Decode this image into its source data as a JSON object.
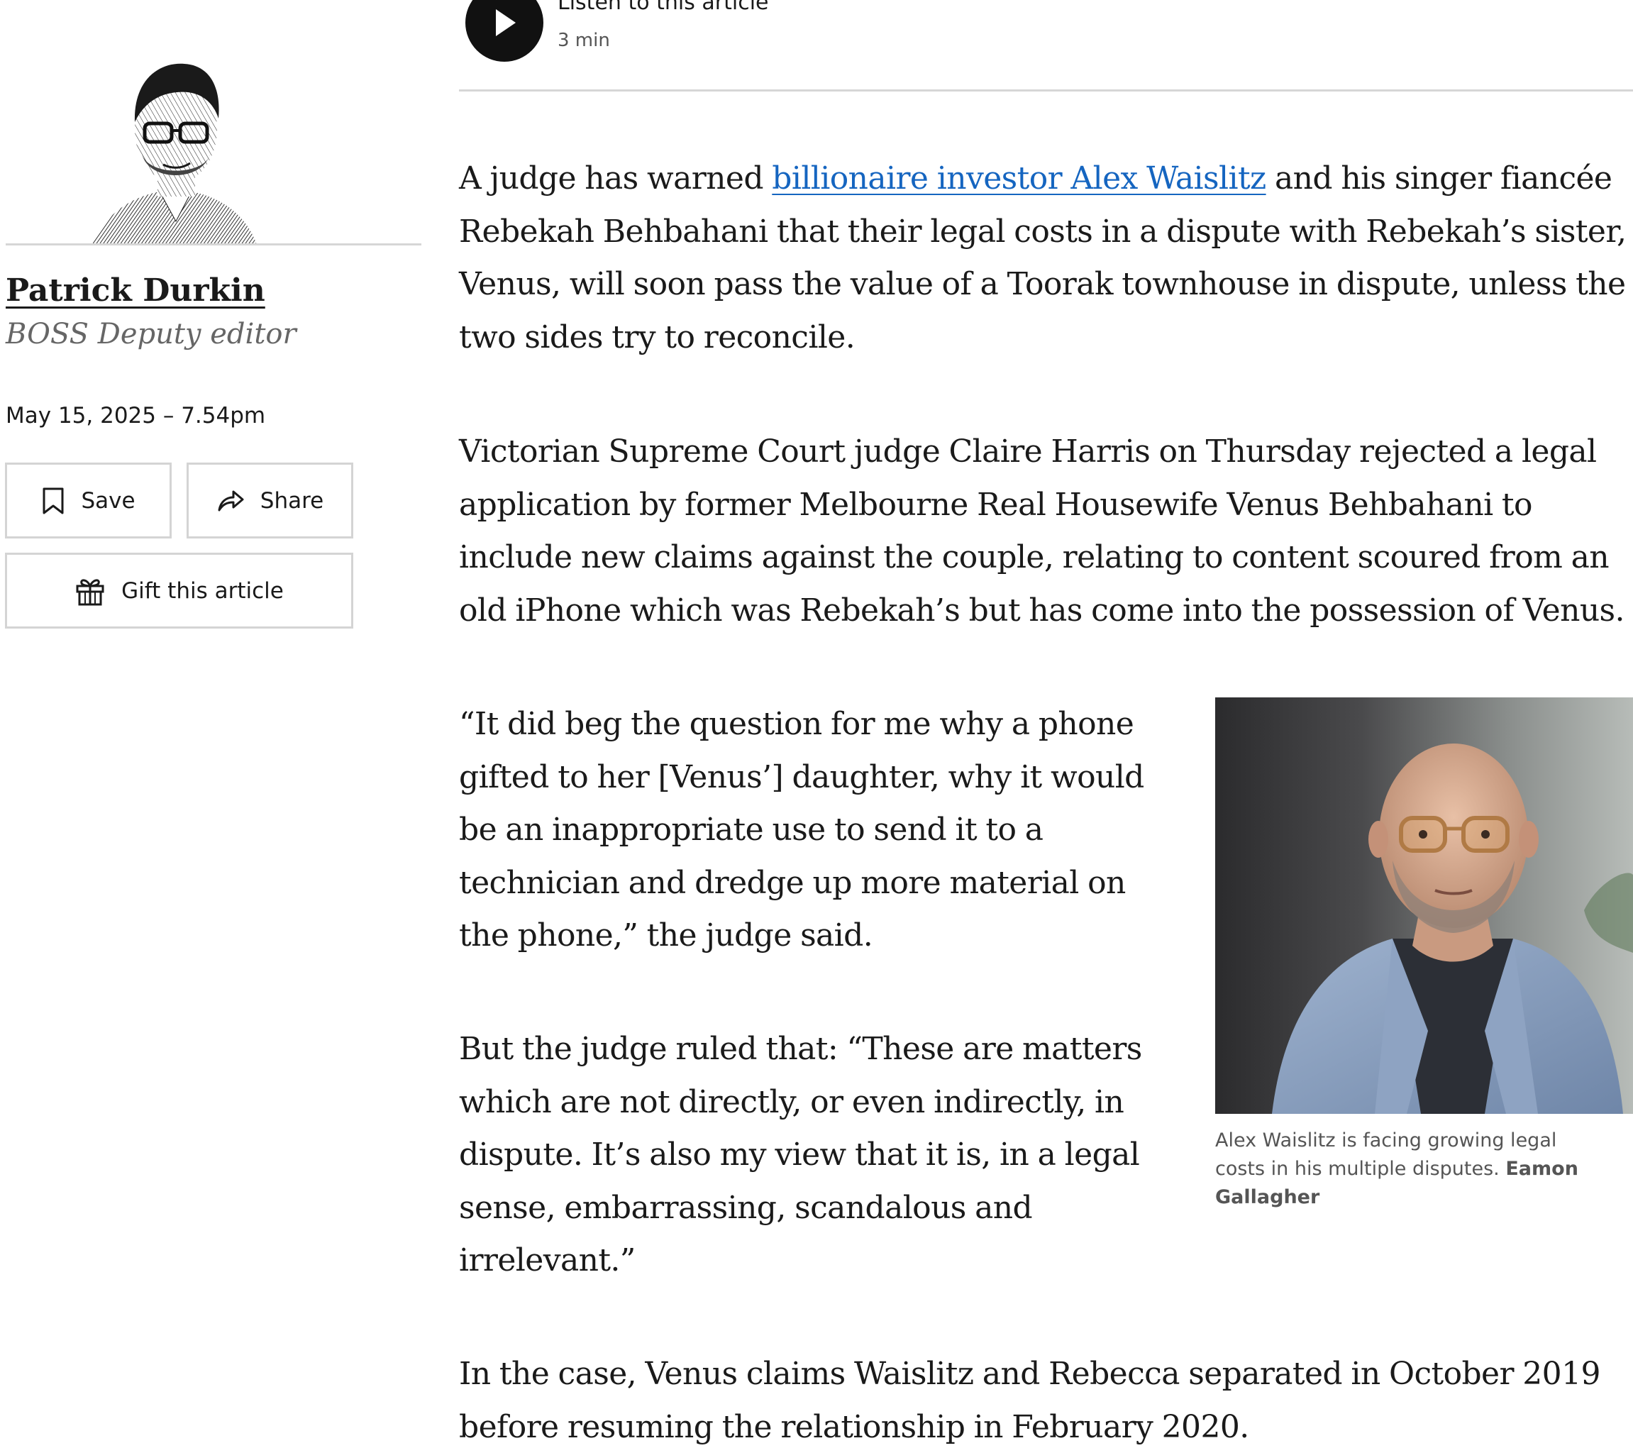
{
  "author": {
    "name": "Patrick Durkin",
    "role": "BOSS Deputy editor",
    "portrait_icon": "author-portrait-engraving"
  },
  "published": "May 15, 2025 – 7.54pm",
  "actions": {
    "save_label": "Save",
    "share_label": "Share",
    "gift_label": "Gift this article",
    "save_icon": "bookmark-icon",
    "share_icon": "share-arrow-icon",
    "gift_icon": "gift-icon"
  },
  "audio": {
    "label": "Listen to this article",
    "duration": "3 min",
    "play_icon": "play-icon"
  },
  "article": {
    "p1": {
      "lead": "A judge has warned ",
      "link_text": "billionaire investor Alex Waislitz",
      "line1_tail": " and his singer fiancée",
      "line2": "Rebekah Behbahani that their legal costs in a dispute with Rebekah’s sister,",
      "line3": "Venus, will soon pass the value of a Toorak townhouse in dispute, unless the",
      "line4": "two sides try to reconcile."
    },
    "p2": [
      "Victorian Supreme Court judge Claire Harris on Thursday rejected a legal",
      "application by former Melbourne Real Housewife Venus Behbahani to",
      "include new claims against the couple, relating to content scoured from an",
      "old iPhone which was Rebekah’s but has come into the possession of Venus."
    ],
    "p3": [
      "“It did beg the question for me why a phone",
      "gifted to her [Venus’] daughter, why it would",
      "be an inappropriate use to send it to a",
      "technician and dredge up more material on",
      "the phone,” the judge said."
    ],
    "p4": [
      "But the judge ruled that: “These are matters",
      "which are not directly, or even indirectly, in",
      "dispute. It’s also my view that it is, in a legal",
      "sense, embarrassing, scandalous and",
      "irrelevant.”"
    ],
    "p5": [
      "In the case, Venus claims Waislitz and Rebecca separated in October 2019",
      "before resuming the relationship in February 2020."
    ]
  },
  "figure": {
    "caption": "Alex Waislitz is facing growing legal costs in his multiple disputes. ",
    "credit": "Eamon Gallagher"
  },
  "colors": {
    "link": "#1565c0",
    "rule": "#d6d6d6",
    "muted_text": "#666666",
    "button_border": "#d4d4d4"
  }
}
